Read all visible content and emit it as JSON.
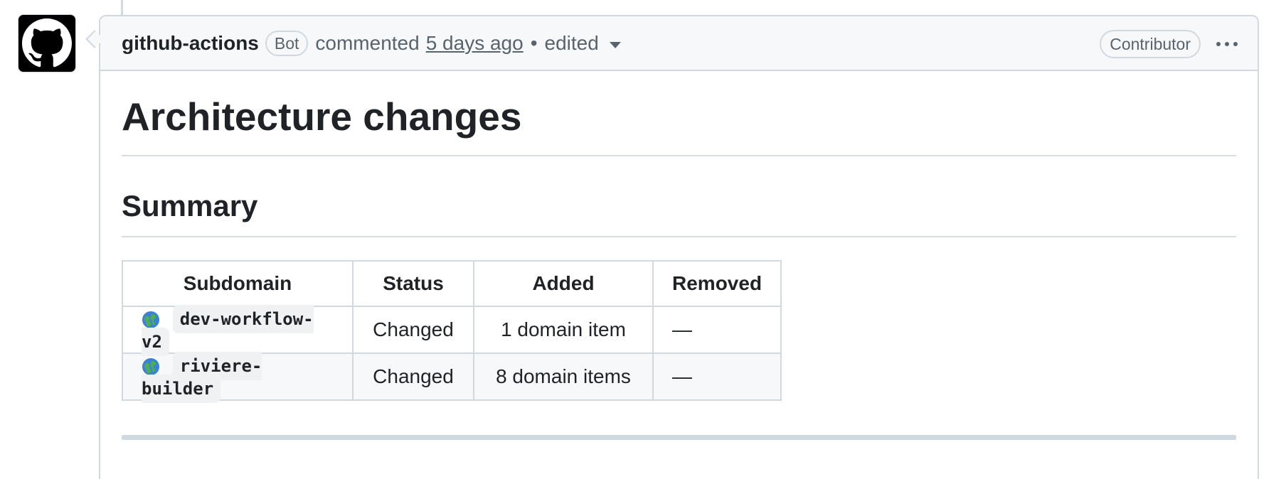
{
  "comment": {
    "author": "github-actions",
    "author_badge": "Bot",
    "action": "commented",
    "time": "5 days ago",
    "separator": "•",
    "edited": "edited",
    "role_badge": "Contributor",
    "more_icon": "kebab-horizontal-icon"
  },
  "body": {
    "title": "Architecture changes",
    "summary_heading": "Summary",
    "table": {
      "headers": [
        "Subdomain",
        "Status",
        "Added",
        "Removed"
      ],
      "rows": [
        {
          "icon": "globe-icon",
          "subdomain": "dev-workflow-v2",
          "status": "Changed",
          "added": "1 domain item",
          "removed": "—"
        },
        {
          "icon": "globe-icon",
          "subdomain": "riviere-builder",
          "status": "Changed",
          "added": "8 domain items",
          "removed": "—"
        }
      ]
    }
  },
  "colors": {
    "border": "#d1d9e0",
    "header_bg": "#f6f8fa",
    "text": "#1f2328",
    "muted": "#59636e"
  }
}
